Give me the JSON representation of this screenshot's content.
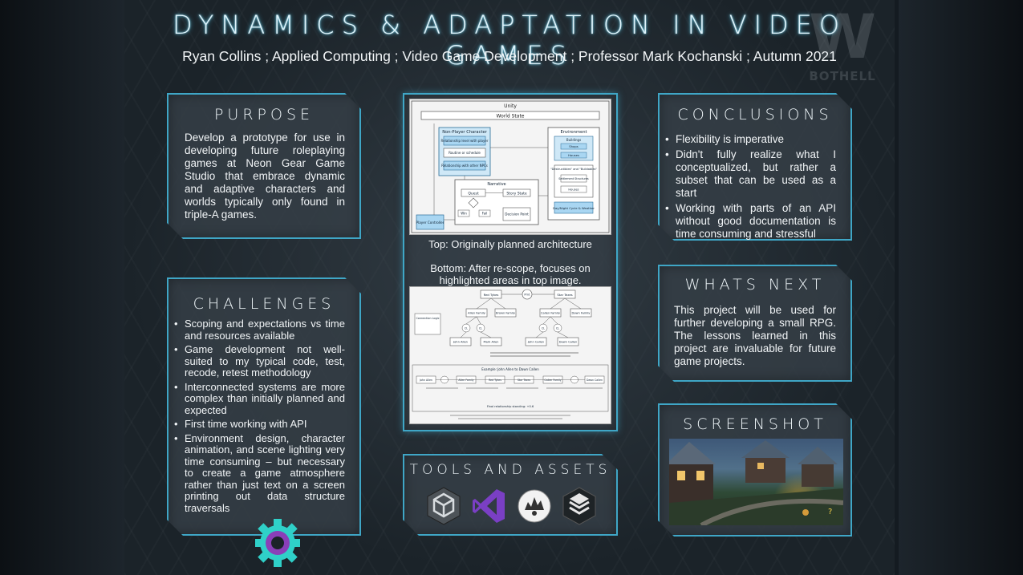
{
  "poster": {
    "title": "DYNAMICS & ADAPTATION IN VIDEO GAMES",
    "subtitle": "Ryan Collins ; Applied Computing ; Video Game Development ; Professor Mark Kochanski ; Autumn 2021",
    "logo": {
      "letter": "W",
      "text": "BOTHELL"
    }
  },
  "purpose": {
    "heading": "PURPOSE",
    "text": "Develop a prototype for use in developing future roleplaying games at Neon Gear Game Studio that embrace dynamic and adaptive characters and worlds typically only found in triple-A games."
  },
  "challenges": {
    "heading": "CHALLENGES",
    "items": [
      "Scoping and expectations vs time and resources available",
      "Game development not well-suited to my typical code, test, recode, retest methodology",
      "Interconnected systems are more complex than initially planned and expected",
      "First time working with API",
      "Environment design, character animation, and scene lighting very time consuming – but necessary to create a game atmosphere rather than just text on a screen printing out data structure traversals"
    ]
  },
  "architecture": {
    "top_caption": "Top: Originally planned architecture",
    "bottom_caption": "Bottom: After re-scope, focuses on highlighted areas in top image.",
    "top_diagram": {
      "unity": "Unity",
      "world_state": "World State",
      "npc": "Non-Player Character",
      "npc_items": [
        "Relationship level with player",
        "Routine or schedule",
        "Relationship with other NPCs"
      ],
      "environment": "Environment",
      "env_items": [
        "Buildings",
        "Shops",
        "Houses"
      ],
      "destructibles": "\"Destructibles\" and \"Buildables\"",
      "destruct_items": [
        "Settlement Structures",
        "Houses"
      ],
      "narrative": "Narrative",
      "quest": "Quest",
      "story_state": "Story State",
      "win": "Win",
      "fail": "Fail",
      "decision": "Decision Point",
      "player": "Player Controller",
      "daynight": "Day/Night Cycle & Weather"
    },
    "bottom_diagram": {
      "nodes_top": [
        "Red Tykes",
        "Prnt",
        "Star Tezes"
      ],
      "families": [
        "Allen Family",
        "Brown Family",
        "Callen Family",
        "Dawn Family"
      ],
      "people": [
        "John Allen",
        "Mark Allen",
        "John Callen",
        "Dawn Callen"
      ],
      "connection": "Connection Logic",
      "cl": "CL",
      "example_title": "Example: John Allen to Dawn Callen",
      "example_nodes": [
        "John Allen",
        "Allen Family",
        "Red Tykes",
        "Star Tezes",
        "Callen Family",
        "Dawn Callen"
      ],
      "final": "Final relationship standing: +0.6"
    }
  },
  "tools": {
    "heading": "TOOLS AND ASSETS",
    "icons": [
      "unity-icon",
      "visual-studio-icon",
      "ultimate-character-controller-icon",
      "stack-icon"
    ]
  },
  "conclusions": {
    "heading": "CONCLUSIONS",
    "items": [
      "Flexibility is imperative",
      "Didn't fully realize what I conceptualized, but rather a subset that can be used as a start",
      "Working with parts of an API without good documentation is time consuming and stressful"
    ]
  },
  "whats_next": {
    "heading": "WHATS NEXT",
    "text": "This project will be used for further developing a small RPG. The lessons learned in this project are invaluable for future game projects."
  },
  "screenshot": {
    "heading": "SCREENSHOT",
    "marker": "?"
  },
  "colors": {
    "accent": "#3fa6c6",
    "panel": "#343e46",
    "highlight": "#bfe3f5"
  }
}
